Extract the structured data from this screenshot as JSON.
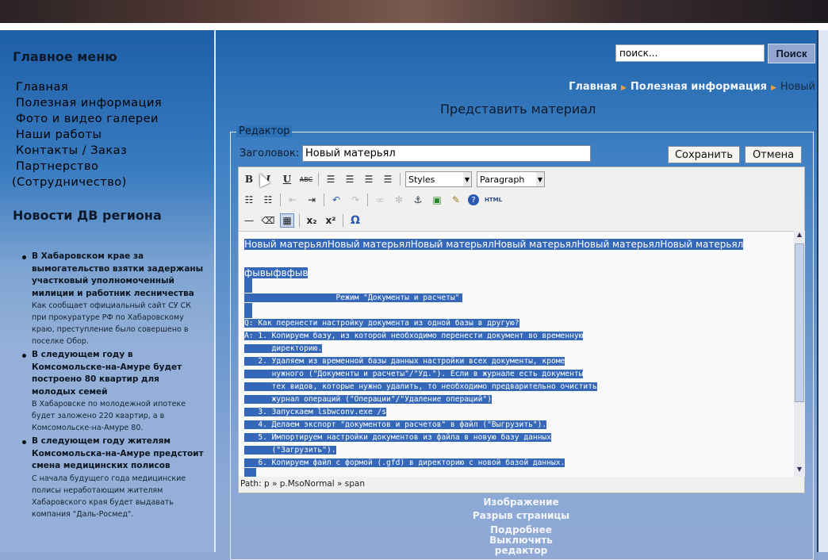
{
  "sidebar": {
    "menu_title": "Главное меню",
    "menu": [
      "Главная",
      "Полезная информация",
      "Фото и видео галереи",
      "Наши работы",
      "Контакты / Заказ",
      "Партнерство",
      "(Сотрудничество)"
    ],
    "news_title": "Новости ДВ региона",
    "news": [
      {
        "title": "В Хабаровском крае за вымогательство взятки задержаны участковый уполномоченный милиции и работник лесничества",
        "desc": "Как сообщает официальный сайт СУ СК при прокуратуре РФ по Хабаровскому краю, преступление было совершено в поселке Обор."
      },
      {
        "title": "В следующем году в Комсомольске-на-Амуре будет построено 80 квартир для молодых семей",
        "desc": "В Хабаровске по молодежной ипотеке будет заложено 220 квартир, а в Комсомольске-на-Амуре 80."
      },
      {
        "title": "В следующем году жителям Комсомольска-на-Амуре предстоит смена медицинских полисов",
        "desc": "С начала будущего года медицинские полисы неработающим жителям Хабаровского края будет выдавать компания \"Даль-Росмед\"."
      }
    ]
  },
  "search": {
    "placeholder": "поиск...",
    "button": "Поиск"
  },
  "breadcrumb": [
    "Главная",
    "Полезная информация",
    "Новый"
  ],
  "page_title": "Представить материал",
  "editor": {
    "legend": "Редактор",
    "title_label": "Заголовок:",
    "title_value": "Новый матерьял",
    "save": "Сохранить",
    "cancel": "Отмена",
    "styles": "Styles",
    "paragraph": "Paragraph",
    "html": "HTML",
    "path": "Path: p » p.MsoNormal » span",
    "lines": [
      "Новый матерьялНовый матерьялНовый матерьялНовый матерьялНовый матерьялНовый матерьял",
      "фывыфвфыв",
      "                    Режим \"Документы и расчеты\"",
      "Q: Как перенести настройку документа из одной базы в другую?",
      "A: 1. Копируем базу, из которой необходимо перенести документ во временную",
      "      директорию.",
      "   2. Удаляем из временной базы данных настройки всех документы, кроме",
      "      нужного (\"Документы и расчеты\"/\"Уд.\"). Если в журнале есть документы",
      "      тех видов, которые нужно удалить, то необходимо предварительно очистить",
      "      журнал операций (\"Операции\"/\"Удаление операций\")",
      "   3. Запускаем lsbwconv.exe /s",
      "   4. Делаем экспорт \"документов и расчетов\" в файл (\"Выгрузить\").",
      "   5. Импортируем настройки документов из файла в новую базу данных",
      "      (\"Загрузить\").",
      "   6. Копируем файл с формой (.gfd) в директорию с новой базой данных."
    ]
  },
  "links": [
    "Изображение",
    "Разрыв страницы",
    "Подробнее",
    "Выключить редактор"
  ]
}
